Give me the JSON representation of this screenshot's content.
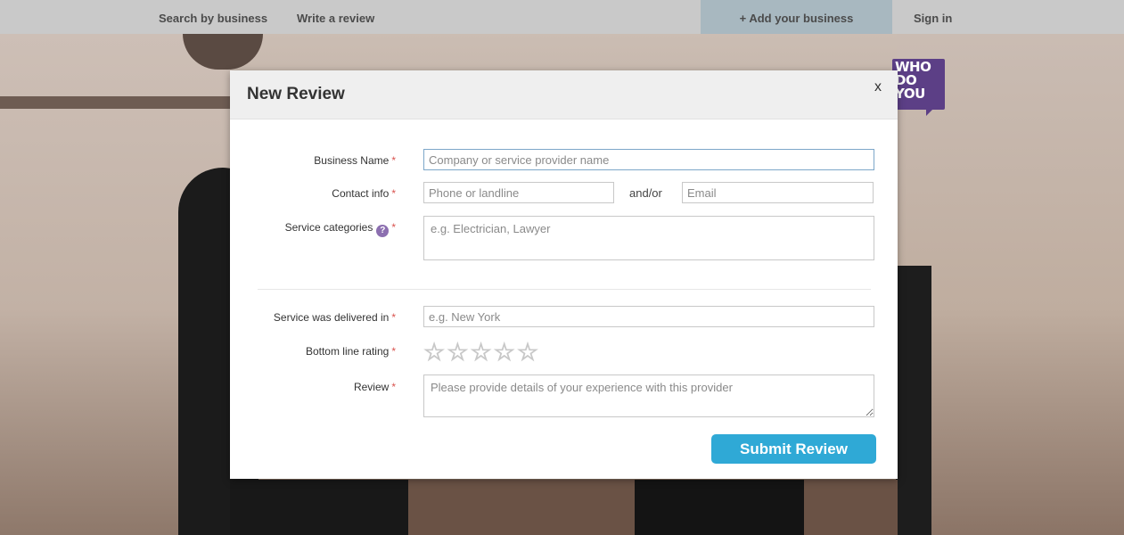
{
  "nav": {
    "search_label": "Search by business",
    "write_label": "Write a review",
    "add_label": "+ Add your business",
    "signin_label": "Sign in"
  },
  "logo": {
    "lines": [
      "WHO",
      "DO",
      "YOU"
    ]
  },
  "modal": {
    "title": "New Review",
    "close_label": "x",
    "business_name": {
      "label": "Business Name",
      "required": "*",
      "placeholder": "Company or service provider name"
    },
    "contact": {
      "label": "Contact info",
      "required": "*",
      "phone_placeholder": "Phone or landline",
      "separator": "and/or",
      "email_placeholder": "Email"
    },
    "categories": {
      "label": "Service categories",
      "help": "?",
      "required": "*",
      "placeholder": "e.g. Electrician, Lawyer"
    },
    "location": {
      "label": "Service was delivered in",
      "required": "*",
      "placeholder": "e.g. New York"
    },
    "rating": {
      "label": "Bottom line rating",
      "required": "*",
      "value": 0,
      "max": 5,
      "star_glyph": "☆"
    },
    "review": {
      "label": "Review",
      "required": "*",
      "placeholder": "Please provide details of your experience with this provider"
    },
    "submit_label": "Submit Review"
  },
  "colors": {
    "accent": "#2fa9d6",
    "brand": "#5c3f86",
    "required": "#d9534f"
  }
}
